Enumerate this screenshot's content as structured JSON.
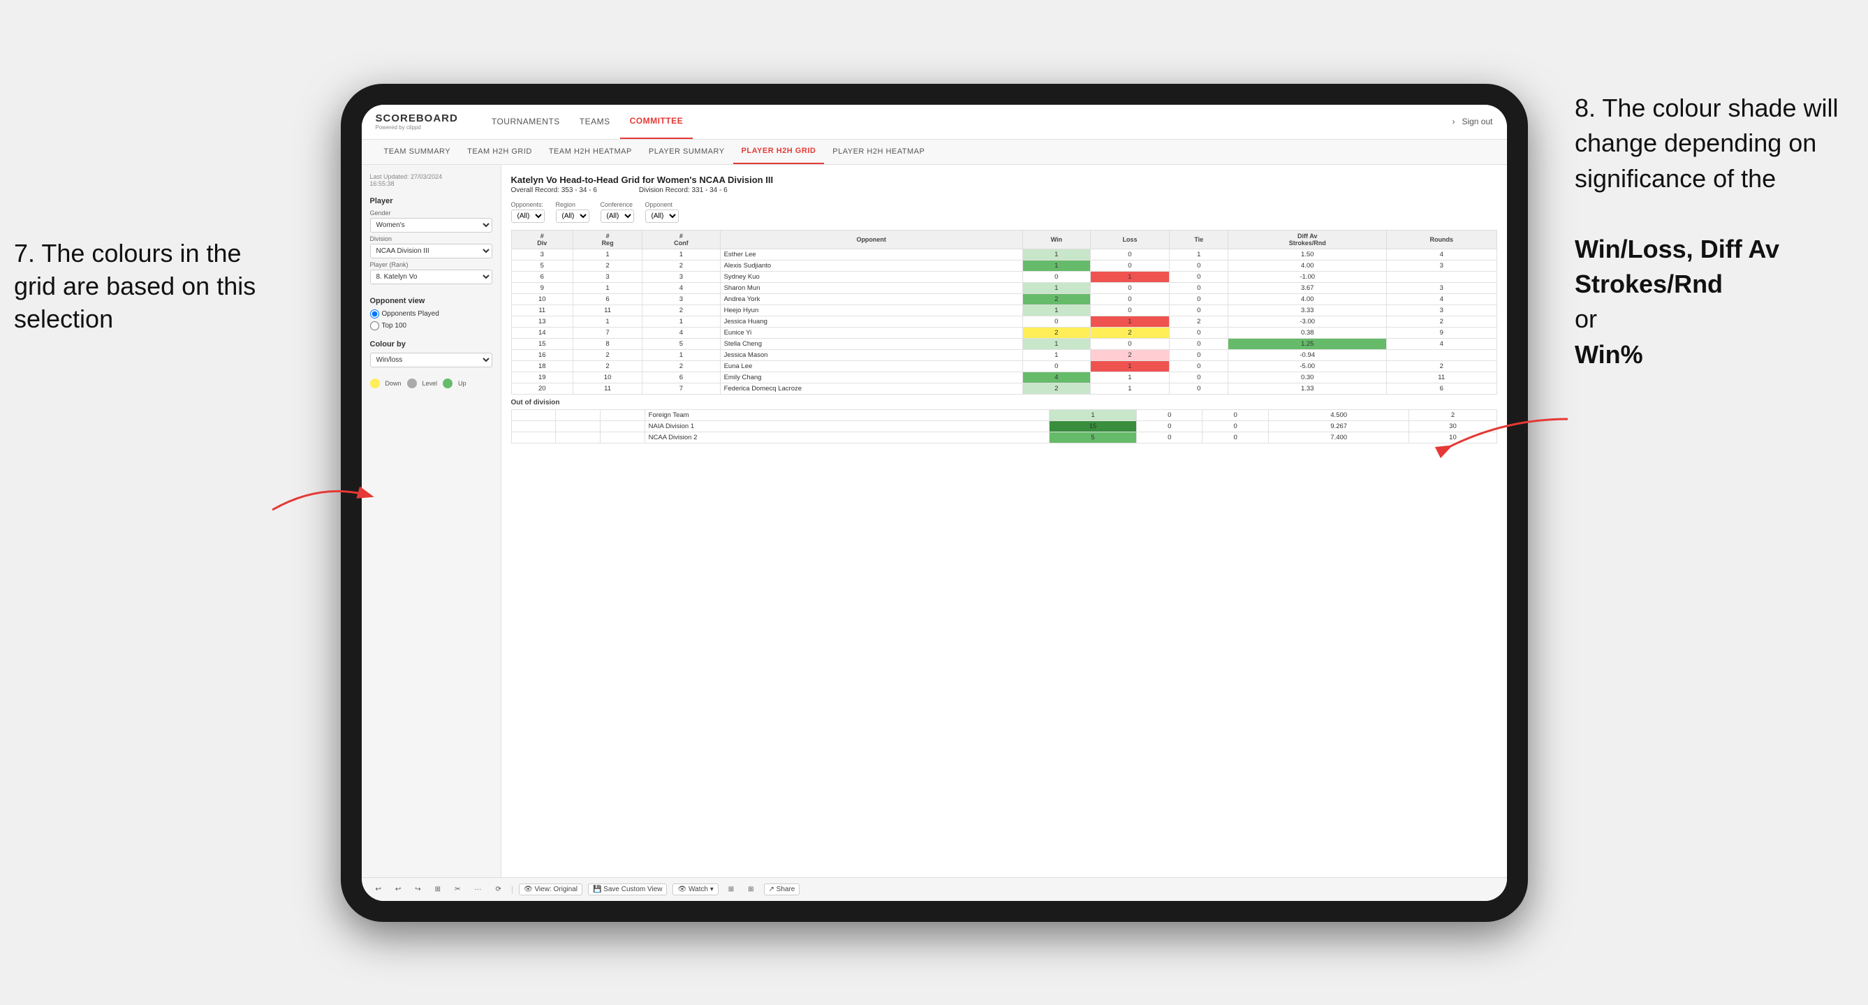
{
  "annotations": {
    "left_title": "7. The colours in the grid are based on this selection",
    "right_title": "8. The colour shade will change depending on significance of the",
    "right_bold1": "Win/Loss,",
    "right_bold2": "Diff Av Strokes/Rnd",
    "right_or": "or",
    "right_bold3": "Win%"
  },
  "nav": {
    "logo": "SCOREBOARD",
    "logo_sub": "Powered by clippd",
    "items": [
      "TOURNAMENTS",
      "TEAMS",
      "COMMITTEE"
    ],
    "active": "COMMITTEE",
    "sign_out": "Sign out"
  },
  "sub_nav": {
    "items": [
      "TEAM SUMMARY",
      "TEAM H2H GRID",
      "TEAM H2H HEATMAP",
      "PLAYER SUMMARY",
      "PLAYER H2H GRID",
      "PLAYER H2H HEATMAP"
    ],
    "active": "PLAYER H2H GRID"
  },
  "left_panel": {
    "last_updated_label": "Last Updated: 27/03/2024",
    "last_updated_time": "16:55:38",
    "player_label": "Player",
    "gender_label": "Gender",
    "gender_value": "Women's",
    "division_label": "Division",
    "division_value": "NCAA Division III",
    "player_rank_label": "Player (Rank)",
    "player_rank_value": "8. Katelyn Vo",
    "opponent_view_label": "Opponent view",
    "radio1": "Opponents Played",
    "radio2": "Top 100",
    "colour_by_label": "Colour by",
    "colour_by_value": "Win/loss",
    "legend": [
      {
        "color": "#ffee58",
        "label": "Down"
      },
      {
        "color": "#aaaaaa",
        "label": "Level"
      },
      {
        "color": "#66bb6a",
        "label": "Up"
      }
    ]
  },
  "grid": {
    "title": "Katelyn Vo Head-to-Head Grid for Women's NCAA Division III",
    "overall_record_label": "Overall Record:",
    "overall_record": "353 - 34 - 6",
    "division_record_label": "Division Record:",
    "division_record": "331 - 34 - 6",
    "filter_opponents_label": "Opponents:",
    "filter_region_label": "Region",
    "filter_conference_label": "Conference",
    "filter_opponent_label": "Opponent",
    "filter_opponents_value": "(All)",
    "filter_region_value": "(All)",
    "filter_conference_value": "(All)",
    "filter_opponent_value": "(All)",
    "columns": [
      "#\nDiv",
      "#\nReg",
      "#\nConf",
      "Opponent",
      "Win",
      "Loss",
      "Tie",
      "Diff Av\nStrokes/Rnd",
      "Rounds"
    ],
    "rows": [
      {
        "div": 3,
        "reg": 1,
        "conf": 1,
        "opponent": "Esther Lee",
        "win": 1,
        "loss": 0,
        "tie": 1,
        "diff": "1.50",
        "rounds": 4,
        "win_color": "light-green-cell",
        "loss_color": "",
        "diff_color": ""
      },
      {
        "div": 5,
        "reg": 2,
        "conf": 2,
        "opponent": "Alexis Sudjianto",
        "win": 1,
        "loss": 0,
        "tie": 0,
        "diff": "4.00",
        "rounds": 3,
        "win_color": "green-cell",
        "loss_color": "",
        "diff_color": ""
      },
      {
        "div": 6,
        "reg": 3,
        "conf": 3,
        "opponent": "Sydney Kuo",
        "win": 0,
        "loss": 1,
        "tie": 0,
        "diff": "-1.00",
        "rounds": "",
        "win_color": "",
        "loss_color": "loss-red",
        "diff_color": ""
      },
      {
        "div": 9,
        "reg": 1,
        "conf": 4,
        "opponent": "Sharon Mun",
        "win": 1,
        "loss": 0,
        "tie": 0,
        "diff": "3.67",
        "rounds": 3,
        "win_color": "light-green-cell",
        "loss_color": "",
        "diff_color": ""
      },
      {
        "div": 10,
        "reg": 6,
        "conf": 3,
        "opponent": "Andrea York",
        "win": 2,
        "loss": 0,
        "tie": 0,
        "diff": "4.00",
        "rounds": 4,
        "win_color": "green-cell",
        "loss_color": "",
        "diff_color": ""
      },
      {
        "div": 11,
        "reg": 11,
        "conf": 2,
        "opponent": "Heejo Hyun",
        "win": 1,
        "loss": 0,
        "tie": 0,
        "diff": "3.33",
        "rounds": 3,
        "win_color": "light-green-cell",
        "loss_color": "",
        "diff_color": ""
      },
      {
        "div": 13,
        "reg": 1,
        "conf": 1,
        "opponent": "Jessica Huang",
        "win": 0,
        "loss": 1,
        "tie": 2,
        "diff": "-3.00",
        "rounds": 2,
        "win_color": "",
        "loss_color": "loss-red",
        "diff_color": ""
      },
      {
        "div": 14,
        "reg": 7,
        "conf": 4,
        "opponent": "Eunice Yi",
        "win": 2,
        "loss": 2,
        "tie": 0,
        "diff": "0.38",
        "rounds": 9,
        "win_color": "yellow-cell",
        "loss_color": "yellow-cell",
        "diff_color": ""
      },
      {
        "div": 15,
        "reg": 8,
        "conf": 5,
        "opponent": "Stella Cheng",
        "win": 1,
        "loss": 0,
        "tie": 0,
        "diff": "1.25",
        "rounds": 4,
        "win_color": "light-green-cell",
        "loss_color": "",
        "diff_color": "green-cell"
      },
      {
        "div": 16,
        "reg": 2,
        "conf": 1,
        "opponent": "Jessica Mason",
        "win": 1,
        "loss": 2,
        "tie": 0,
        "diff": "-0.94",
        "rounds": "",
        "win_color": "",
        "loss_color": "loss-light-red",
        "diff_color": ""
      },
      {
        "div": 18,
        "reg": 2,
        "conf": 2,
        "opponent": "Euna Lee",
        "win": 0,
        "loss": 1,
        "tie": 0,
        "diff": "-5.00",
        "rounds": 2,
        "win_color": "",
        "loss_color": "loss-red",
        "diff_color": ""
      },
      {
        "div": 19,
        "reg": 10,
        "conf": 6,
        "opponent": "Emily Chang",
        "win": 4,
        "loss": 1,
        "tie": 0,
        "diff": "0.30",
        "rounds": 11,
        "win_color": "green-cell",
        "loss_color": "",
        "diff_color": ""
      },
      {
        "div": 20,
        "reg": 11,
        "conf": 7,
        "opponent": "Federica Domecq Lacroze",
        "win": 2,
        "loss": 1,
        "tie": 0,
        "diff": "1.33",
        "rounds": 6,
        "win_color": "light-green-cell",
        "loss_color": "",
        "diff_color": ""
      }
    ],
    "out_of_division_label": "Out of division",
    "out_of_division_rows": [
      {
        "opponent": "Foreign Team",
        "win": 1,
        "loss": 0,
        "tie": 0,
        "diff": "4.500",
        "rounds": 2,
        "win_color": "light-green-cell"
      },
      {
        "opponent": "NAIA Division 1",
        "win": 15,
        "loss": 0,
        "tie": 0,
        "diff": "9.267",
        "rounds": 30,
        "win_color": "dark-green-cell"
      },
      {
        "opponent": "NCAA Division 2",
        "win": 5,
        "loss": 0,
        "tie": 0,
        "diff": "7.400",
        "rounds": 10,
        "win_color": "green-cell"
      }
    ]
  },
  "toolbar": {
    "buttons": [
      "↩",
      "↩",
      "↪",
      "⊞",
      "✂",
      "·",
      "⟳",
      "|",
      "👁 View: Original",
      "💾 Save Custom View",
      "👁 Watch ▾",
      "⊞",
      "⊞",
      "Share"
    ]
  }
}
